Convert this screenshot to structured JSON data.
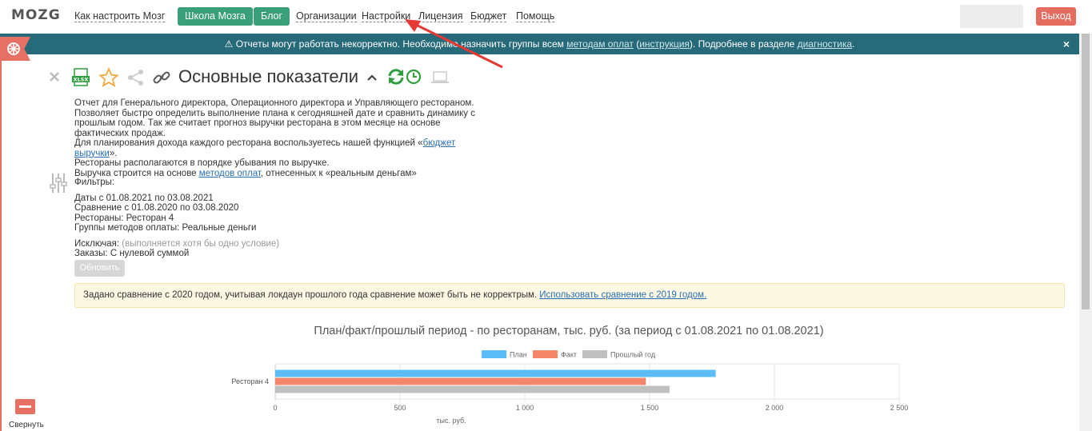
{
  "nav": {
    "logo": "MOZG",
    "links": [
      "Как настроить Мозг",
      "Организации",
      "Настройки",
      "Лицензия",
      "Бюджет",
      "Помощь"
    ],
    "school_btn": "Школа Мозга",
    "blog_btn": "Блог",
    "logout_btn": "Выход"
  },
  "banner": {
    "text_before": "Отчеты могут работать некорректно. Необходимо назначить группы всем ",
    "link1": "методам оплат",
    "paren_open": " (",
    "link2": "инструкция",
    "text_mid": "). Подробнее в разделе ",
    "link3": "диагностика",
    "text_end": ".",
    "close": "×"
  },
  "report": {
    "title": "Основные показатели",
    "desc_line1": "Отчет для Генерального директора, Операционного директора и Управляющего рестораном.",
    "desc_line2": "Позволяет быстро определить выполнение плана к сегодняшней дате и сравнить динамику с прошлым годом. Так же считает прогноз выручки ресторана в этом месяце на основе фактических продаж.",
    "desc_line3_before": "Для планирования дохода каждого ресторана воспользуетесь нашей функцией «",
    "desc_line3_link": "бюджет выручки",
    "desc_line3_after": "».",
    "desc_line4": "Рестораны располагаются в порядке убывания по выручке.",
    "desc_line5_before": "Выручка строится на основе ",
    "desc_line5_link": "методов оплат",
    "desc_line5_after": ", отнесенных к «реальным деньгам»"
  },
  "filters": {
    "heading": "Фильтры:",
    "dates": "Даты с 01.08.2021 по 03.08.2021",
    "comparison": "Сравнение с 01.08.2020 по 03.08.2020",
    "restaurants": "Рестораны: Ресторан 4",
    "payment_groups": "Группы методов оплаты: Реальные деньги",
    "excluding_label": "Исключая:",
    "excluding_hint": "(выполняется хотя бы одно условие)",
    "orders": "Заказы: С нулевой суммой",
    "refresh_btn": "Обновить"
  },
  "notice": {
    "text": "Задано сравнение с 2020 годом, учитывая локдаун прошлого года сравнение может быть не корректрым. ",
    "link": "Использовать сравнение с 2019 годом."
  },
  "sidebar": {
    "collapse_label": "Свернуть"
  },
  "colors": {
    "accent_green": "#3aa07a",
    "banner": "#276a79",
    "danger": "#e57063",
    "plan": "#5bbcf6",
    "fact": "#f4866a",
    "prev": "#c0c0c0"
  },
  "chart_data": {
    "type": "bar",
    "orientation": "horizontal",
    "title": "План/факт/прошлый период - по ресторанам, тыс. руб. (за период с 01.08.2021 по 01.08.2021)",
    "categories": [
      "Ресторан 4"
    ],
    "series": [
      {
        "name": "План",
        "values": [
          1765
        ],
        "color": "#5bbcf6"
      },
      {
        "name": "Факт",
        "values": [
          1485
        ],
        "color": "#f4866a"
      },
      {
        "name": "Прошлый год",
        "values": [
          1580
        ],
        "color": "#c0c0c0"
      }
    ],
    "xlabel": "тыс. руб.",
    "xlim": [
      0,
      2500
    ],
    "xticks": [
      "0",
      "500",
      "1 000",
      "1 500",
      "2 000",
      "2 500"
    ],
    "grid": true,
    "legend": "top"
  }
}
